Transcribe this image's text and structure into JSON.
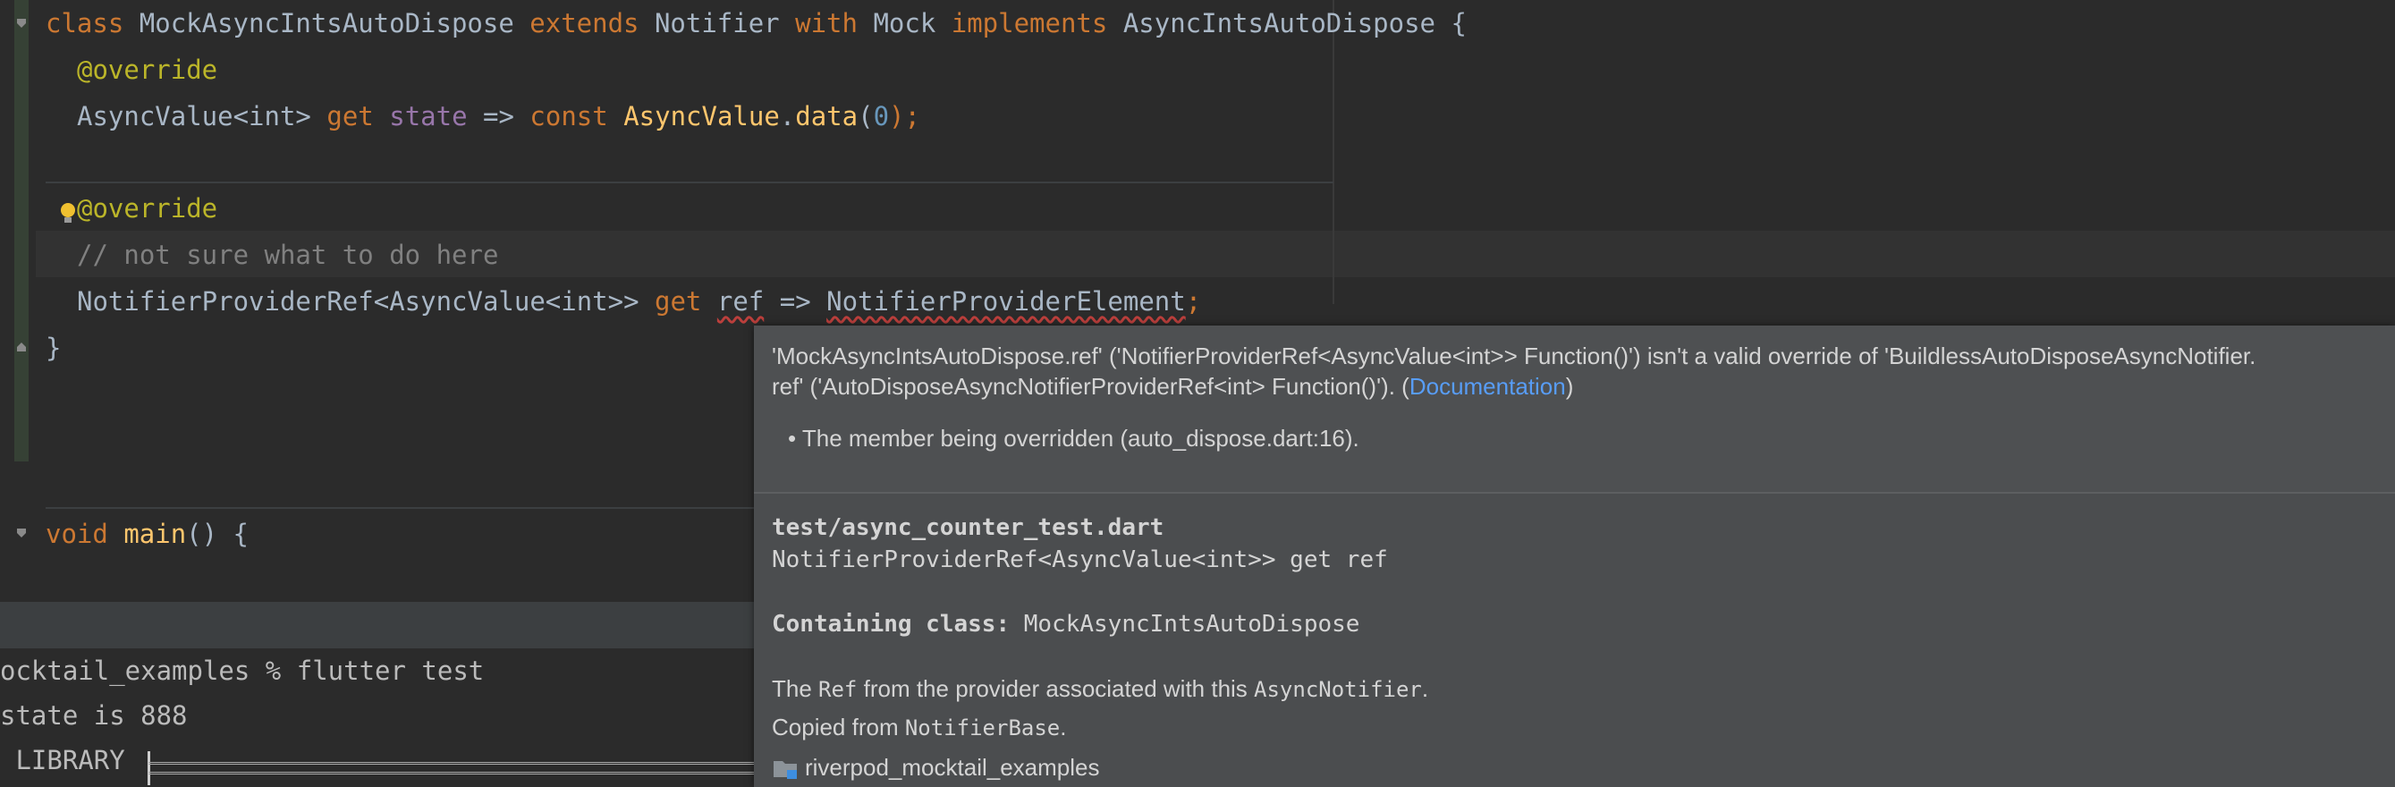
{
  "editor": {
    "line1": {
      "kw_class": "class",
      "name": "MockAsyncIntsAutoDispose",
      "kw_extends": "extends",
      "base": "Notifier",
      "kw_with": "with",
      "mixin": "Mock",
      "kw_implements": "implements",
      "iface": "AsyncIntsAutoDispose",
      "brace": "{"
    },
    "line2": {
      "annotation": "@override"
    },
    "line3": {
      "type": "AsyncValue<int>",
      "kw_get": "get",
      "prop": "state",
      "arrow": "=>",
      "kw_const": "const",
      "cls": "AsyncValue",
      "dot": ".",
      "method": "data",
      "open": "(",
      "num": "0",
      "close": ");"
    },
    "line4": {
      "annotation": "@override"
    },
    "line5": {
      "comment": "// not sure what to do here"
    },
    "line6": {
      "type": "NotifierProviderRef<AsyncValue<int>>",
      "kw_get": "get",
      "prop": "ref",
      "arrow": "=>",
      "value": "NotifierProviderElement",
      "semi": ";"
    },
    "line7": {
      "brace": "}"
    },
    "line8": {
      "kw_void": "void",
      "fn": "main",
      "rest": "() {"
    }
  },
  "terminal": {
    "line1": "ocktail_examples % flutter test",
    "line2": "state is 888",
    "line3": " LIBRARY "
  },
  "popup": {
    "error_line1": "'MockAsyncIntsAutoDispose.ref' ('NotifierProviderRef<AsyncValue<int>> Function()') isn't a valid override of 'BuildlessAutoDisposeAsyncNotifier.",
    "error_line2_prefix": "ref' ('AutoDisposeAsyncNotifierProviderRef<int> Function()'). (",
    "doc_link": "Documentation",
    "error_line2_suffix": ")",
    "bullet": "• The member being overridden (auto_dispose.dart:16).",
    "file": "test/async_counter_test.dart",
    "signature": "NotifierProviderRef<AsyncValue<int>> get ref",
    "containing_label": "Containing class:",
    "containing_value": " MockAsyncIntsAutoDispose",
    "desc_prefix": "The ",
    "desc_ref": "Ref",
    "desc_mid": " from the provider associated with this ",
    "desc_cls": "AsyncNotifier",
    "desc_end": ".",
    "copied_prefix": "Copied from ",
    "copied_cls": "NotifierBase",
    "copied_end": ".",
    "package": "riverpod_mocktail_examples"
  },
  "colors": {
    "keyword": "#cc7832",
    "annotation": "#bbb529",
    "function": "#ffc66d",
    "number": "#6897bb",
    "property": "#9876aa",
    "link": "#589df6",
    "error": "#bc3f3c"
  }
}
